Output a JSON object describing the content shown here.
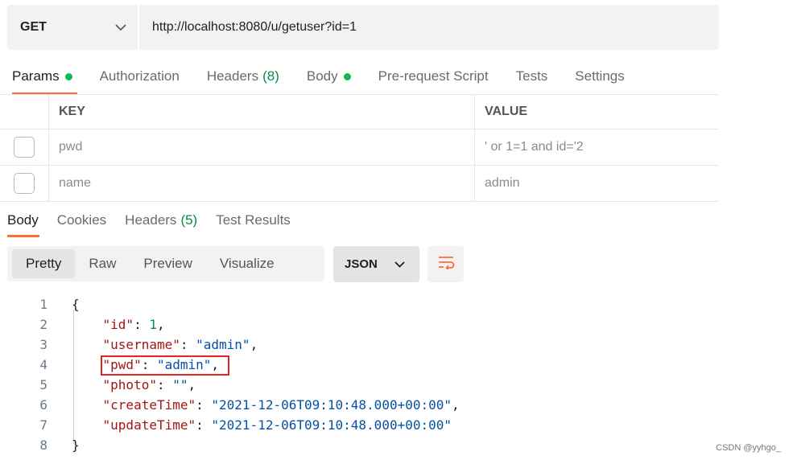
{
  "request": {
    "method": "GET",
    "url": "http://localhost:8080/u/getuser?id=1"
  },
  "request_tabs": [
    {
      "label": "Params",
      "dot": true
    },
    {
      "label": "Authorization"
    },
    {
      "label": "Headers",
      "count": "(8)"
    },
    {
      "label": "Body",
      "dot": true
    },
    {
      "label": "Pre-request Script"
    },
    {
      "label": "Tests"
    },
    {
      "label": "Settings"
    }
  ],
  "params": {
    "header_key": "KEY",
    "header_value": "VALUE",
    "rows": [
      {
        "key": "pwd",
        "value": "' or 1=1 and id='2",
        "checked": false
      },
      {
        "key": "name",
        "value": "admin",
        "checked": false
      }
    ]
  },
  "response_tabs": [
    {
      "label": "Body"
    },
    {
      "label": "Cookies"
    },
    {
      "label": "Headers",
      "count": "(5)"
    },
    {
      "label": "Test Results"
    }
  ],
  "view_modes": [
    "Pretty",
    "Raw",
    "Preview",
    "Visualize"
  ],
  "format": "JSON",
  "code_lines": [
    "1",
    "2",
    "3",
    "4",
    "5",
    "6",
    "7",
    "8"
  ],
  "json": {
    "open_brace": "{",
    "close_brace": "}",
    "id_key": "\"id\"",
    "id_value": "1",
    "username_key": "\"username\"",
    "username_value": "\"admin\"",
    "pwd_key": "\"pwd\"",
    "pwd_value": "\"admin\"",
    "photo_key": "\"photo\"",
    "photo_value": "\"\"",
    "createTime_key": "\"createTime\"",
    "createTime_value": "\"2021-12-06T09:10:48.000+00:00\"",
    "updateTime_key": "\"updateTime\"",
    "updateTime_value": "\"2021-12-06T09:10:48.000+00:00\""
  },
  "watermark": "CSDN @yyhgo_",
  "colors": {
    "accent": "#ff6c37",
    "dot": "#0cbb52",
    "highlight": "#e32222"
  }
}
